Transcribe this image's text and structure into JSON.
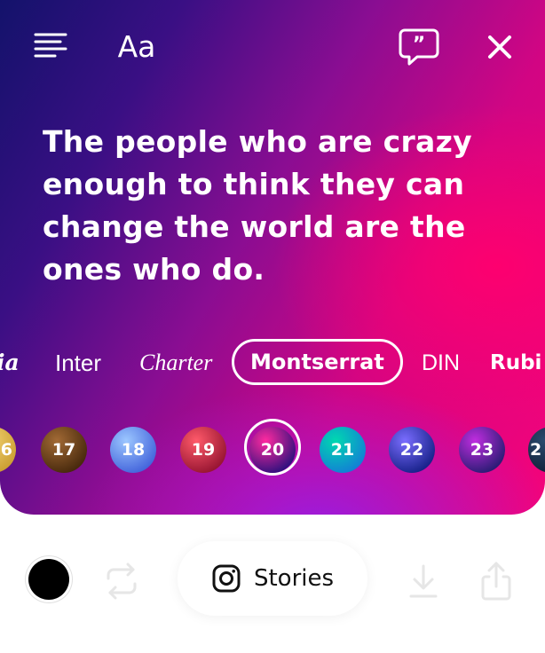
{
  "header": {
    "font_button_label": "Aa"
  },
  "quote": {
    "text": "The people who are crazy enough to think they can change the world are the ones who do."
  },
  "fonts": [
    {
      "label": "ia",
      "selected": false
    },
    {
      "label": "Inter",
      "selected": false
    },
    {
      "label": "Charter",
      "selected": false
    },
    {
      "label": "Montserrat",
      "selected": true
    },
    {
      "label": "DIN",
      "selected": false
    },
    {
      "label": "Rubi",
      "selected": false
    }
  ],
  "swatches": [
    {
      "label": "6",
      "colors": [
        "#f7d77a",
        "#c79a2c"
      ]
    },
    {
      "label": "17",
      "colors": [
        "#a26a35",
        "#3e2208"
      ]
    },
    {
      "label": "18",
      "colors": [
        "#9cc7ff",
        "#3b5bd8"
      ]
    },
    {
      "label": "19",
      "colors": [
        "#ff5a6a",
        "#8d0e2c"
      ]
    },
    {
      "label": "20",
      "colors": [
        "#ff2aa0",
        "#1b0e7a"
      ],
      "selected": true
    },
    {
      "label": "21",
      "colors": [
        "#00d9b0",
        "#1477d8"
      ]
    },
    {
      "label": "22",
      "colors": [
        "#7a6dff",
        "#0e1a7e"
      ]
    },
    {
      "label": "23",
      "colors": [
        "#c02de0",
        "#1c1a6a"
      ]
    },
    {
      "label": "2",
      "colors": [
        "#2a4b6e",
        "#0e1c33"
      ]
    }
  ],
  "toolbar": {
    "stories_label": "Stories",
    "text_color": "#000000"
  },
  "colors": {
    "accent_pink": "#f4037a",
    "deep_blue": "#13126b"
  }
}
